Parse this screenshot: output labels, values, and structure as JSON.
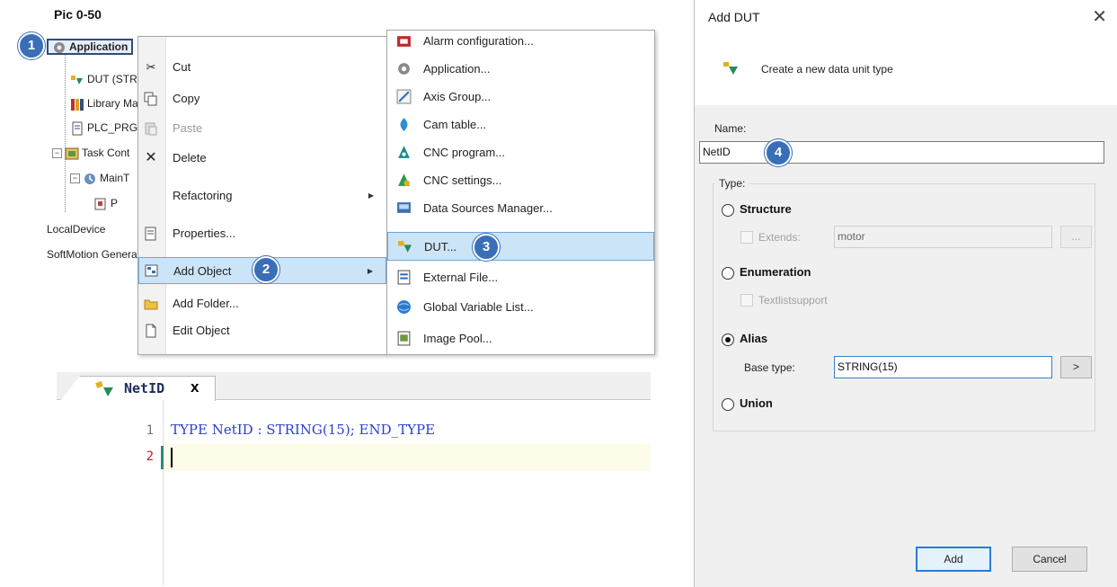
{
  "caption": "Pic 0-50",
  "steps": [
    "1",
    "2",
    "3",
    "4"
  ],
  "tree": {
    "items": [
      {
        "name": "tree-application",
        "label": "Application",
        "icon": "gear-icon"
      },
      {
        "name": "tree-dut",
        "label": "DUT (STR",
        "icon": "dut-icon"
      },
      {
        "name": "tree-library-manager",
        "label": "Library Ma",
        "icon": "library-icon"
      },
      {
        "name": "tree-plc-prg",
        "label": "PLC_PRG",
        "icon": "program-icon"
      },
      {
        "name": "tree-task-config",
        "label": "Task Cont",
        "icon": "task-config-icon"
      },
      {
        "name": "tree-maintask",
        "label": "MainT",
        "icon": "task-icon"
      },
      {
        "name": "tree-program-call",
        "label": "P",
        "icon": "program-call-icon"
      },
      {
        "name": "tree-localdevice",
        "label": "LocalDevice",
        "icon": ""
      },
      {
        "name": "tree-softmotion",
        "label": "SoftMotion Genera",
        "icon": ""
      }
    ]
  },
  "context_menu": {
    "items": [
      {
        "label": "Cut",
        "icon": "scissors-icon",
        "disabled": false
      },
      {
        "label": "Copy",
        "icon": "copy-icon",
        "disabled": false
      },
      {
        "label": "Paste",
        "icon": "paste-icon",
        "disabled": true
      },
      {
        "label": "Delete",
        "icon": "delete-icon",
        "disabled": false
      },
      {
        "label": "Refactoring",
        "icon": "",
        "disabled": false,
        "submenu": true
      },
      {
        "label": "Properties...",
        "icon": "properties-icon",
        "disabled": false
      },
      {
        "label": "Add Object",
        "icon": "add-object-icon",
        "disabled": false,
        "submenu": true,
        "highlighted": true
      },
      {
        "label": "Add Folder...",
        "icon": "folder-icon",
        "disabled": false
      },
      {
        "label": "Edit Object",
        "icon": "edit-object-icon",
        "disabled": false
      }
    ]
  },
  "submenu": {
    "items": [
      {
        "label": "Alarm configuration...",
        "icon": "alarm-icon"
      },
      {
        "label": "Application...",
        "icon": "gear-icon"
      },
      {
        "label": "Axis Group...",
        "icon": "axis-group-icon"
      },
      {
        "label": "Cam table...",
        "icon": "cam-table-icon"
      },
      {
        "label": "CNC program...",
        "icon": "cnc-program-icon"
      },
      {
        "label": "CNC settings...",
        "icon": "cnc-settings-icon"
      },
      {
        "label": "Data Sources Manager...",
        "icon": "data-sources-icon"
      },
      {
        "label": "DUT...",
        "icon": "dut-icon",
        "highlighted": true
      },
      {
        "label": "External File...",
        "icon": "external-file-icon"
      },
      {
        "label": "Global Variable List...",
        "icon": "globe-icon"
      },
      {
        "label": "Image Pool...",
        "icon": "image-pool-icon"
      }
    ]
  },
  "editor": {
    "tab_title": "NetID",
    "close_glyph": "x",
    "line_numbers": [
      "1",
      "2"
    ],
    "code_lines": [
      "TYPE NetID : STRING(15); END_TYPE",
      ""
    ]
  },
  "dialog": {
    "title": "Add DUT",
    "description": "Create a new data unit type",
    "name_label": "Name:",
    "name_value": "NetID",
    "type_label": "Type:",
    "structure_label": "Structure",
    "extends_label": "Extends:",
    "extends_value": "motor",
    "browse_label": "...",
    "enumeration_label": "Enumeration",
    "textlist_label": "Textlistsupport",
    "alias_label": "Alias",
    "base_type_label": "Base type:",
    "base_type_value": "STRING(15)",
    "base_type_button": ">",
    "union_label": "Union",
    "add_button": "Add",
    "cancel_button": "Cancel",
    "selected_type": "Alias"
  },
  "colors": {
    "badge": "#3a6fb8",
    "highlight": "#cce4f7",
    "keyword": "#2a3fd0",
    "default_button_border": "#2a7ad8"
  }
}
